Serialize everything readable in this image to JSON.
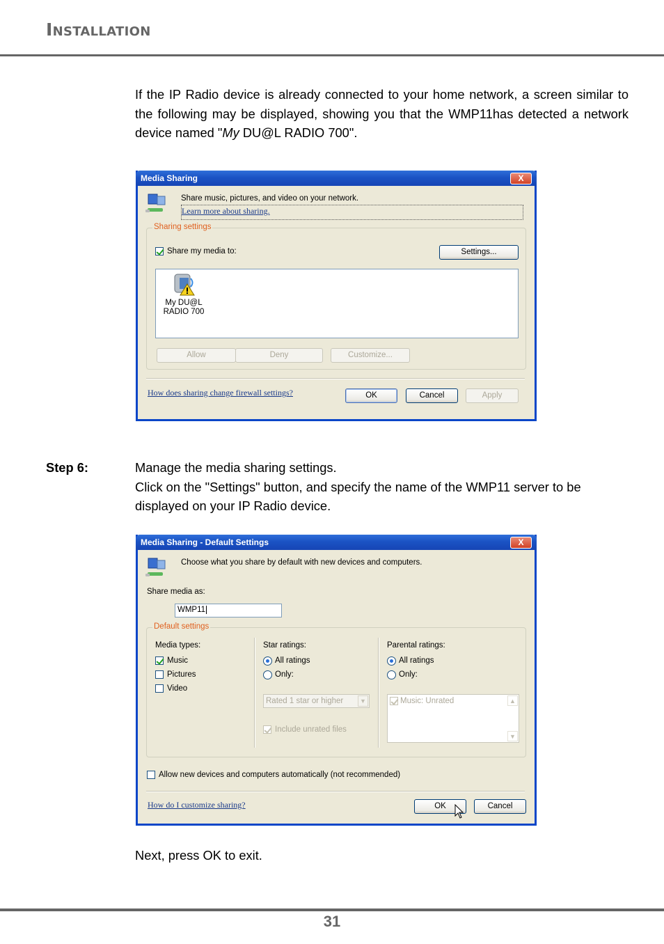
{
  "header": {
    "title": "Installation"
  },
  "intro": {
    "text_before": "If the IP Radio device is already connected to your home network, a screen similar to the following may be displayed, showing you that the WMP11has detected a network device named \"",
    "text_italic": "My",
    "text_after": " DU@L RADIO 700\"."
  },
  "dialog1": {
    "title": "Media Sharing",
    "close_label": "X",
    "description": "Share music, pictures, and video on your network.",
    "learn_more_link": "Learn more about sharing.",
    "group_label": "Sharing settings",
    "share_checkbox_label": "Share my media to:",
    "share_checked": true,
    "settings_button": "Settings...",
    "device": {
      "name_line1": "My DU@L",
      "name_line2": "RADIO 700",
      "icon": "media-device-warning-icon"
    },
    "allow_button": "Allow",
    "deny_button": "Deny",
    "customize_button": "Customize...",
    "firewall_link": "How does sharing change firewall settings?",
    "ok_button": "OK",
    "cancel_button": "Cancel",
    "apply_button": "Apply"
  },
  "step6": {
    "label": "Step 6:",
    "line1": "Manage the media sharing settings.",
    "line2": "Click on the \"Settings\" button, and specify the name of the WMP11 server to be displayed on your IP Radio device."
  },
  "dialog2": {
    "title": "Media Sharing - Default Settings",
    "close_label": "X",
    "description": "Choose what you share by default with new devices and computers.",
    "share_as_label": "Share media as:",
    "share_as_value": "WMP11",
    "group_label": "Default settings",
    "media_types": {
      "label": "Media types:",
      "items": [
        {
          "label": "Music",
          "checked": true
        },
        {
          "label": "Pictures",
          "checked": false
        },
        {
          "label": "Video",
          "checked": false
        }
      ]
    },
    "star_ratings": {
      "label": "Star ratings:",
      "all_label": "All ratings",
      "only_label": "Only:",
      "selected": "All ratings",
      "combo_value": "Rated 1 star or higher",
      "include_unrated_label": "Include unrated files",
      "include_unrated_checked": true
    },
    "parental_ratings": {
      "label": "Parental ratings:",
      "all_label": "All ratings",
      "only_label": "Only:",
      "selected": "All ratings",
      "list_items": [
        {
          "label": "Music: Unrated",
          "checked": true
        }
      ]
    },
    "allow_auto_label": "Allow new devices and computers automatically (not recommended)",
    "allow_auto_checked": false,
    "customize_link": "How do I customize sharing?",
    "ok_button": "OK",
    "cancel_button": "Cancel"
  },
  "outro": {
    "text": "Next, press OK to exit."
  },
  "footer": {
    "page_number": "31"
  }
}
